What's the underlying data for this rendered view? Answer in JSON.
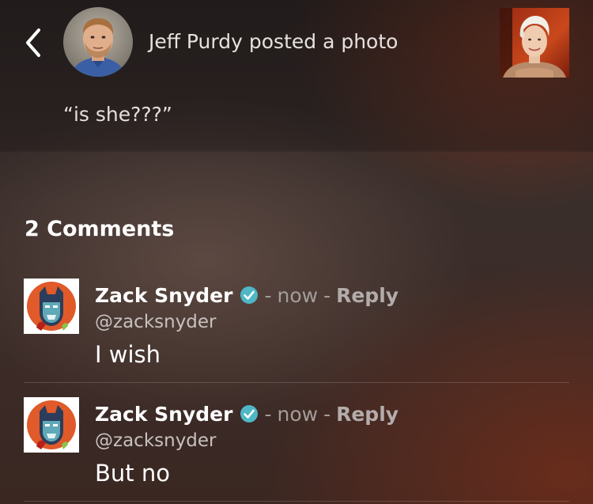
{
  "header": {
    "back_icon": "chevron-left-icon",
    "poster_name": "Jeff Purdy",
    "action_text": "posted a photo",
    "caption": "“is she???”"
  },
  "comments_section": {
    "heading": "2 Comments",
    "separator": "-",
    "items": [
      {
        "author": "Zack Snyder",
        "verified": true,
        "time": "now",
        "reply_label": "Reply",
        "handle": "@zacksnyder",
        "text": "I wish"
      },
      {
        "author": "Zack Snyder",
        "verified": true,
        "time": "now",
        "reply_label": "Reply",
        "handle": "@zacksnyder",
        "text": "But no"
      }
    ]
  },
  "colors": {
    "verified_badge": "#4fb7c6",
    "accent_warm": "#8c371e",
    "comment_avatar_bg": "#e05a2a"
  }
}
